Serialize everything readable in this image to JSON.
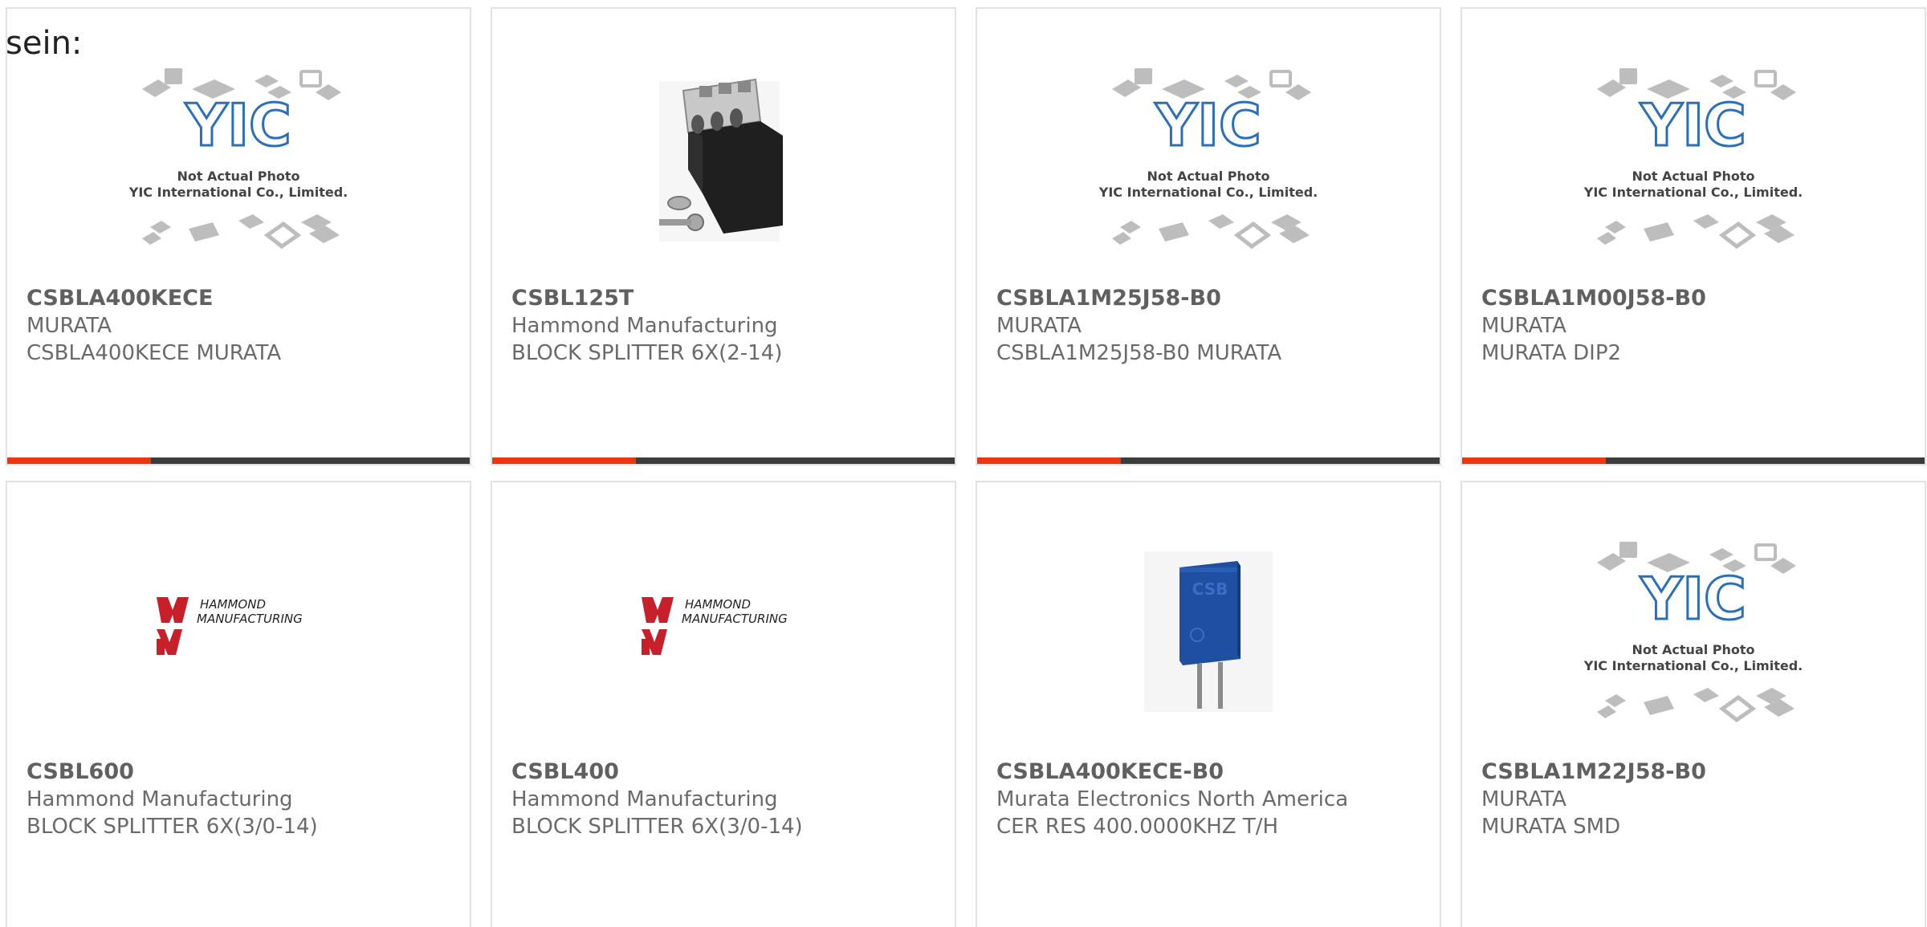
{
  "lead_text": "sein:",
  "colors": {
    "accent": "#e8380f",
    "track": "#3c3c3c",
    "yic_blue": "#2b6fb8",
    "hammond_red": "#c8202a",
    "csb_blue": "#1f4fa0"
  },
  "image_text": {
    "yic_logo": "YIC",
    "not_actual_line1": "Not Actual Photo",
    "not_actual_line2": "YIC International Co., Limited.",
    "hammond_line1": "HAMMOND",
    "hammond_line2": "MANUFACTURING",
    "csb_label": "CSB"
  },
  "products": [
    {
      "part_number": "CSBLA400KECE",
      "manufacturer": "MURATA",
      "description": "CSBLA400KECE MURATA",
      "image": "yic-placeholder",
      "progress": 0.31
    },
    {
      "part_number": "CSBL125T",
      "manufacturer": "Hammond Manufacturing",
      "description": "BLOCK SPLITTER 6X(2-14)",
      "image": "splitter-block-photo",
      "progress": 0.31
    },
    {
      "part_number": "CSBLA1M25J58-B0",
      "manufacturer": "MURATA",
      "description": "CSBLA1M25J58-B0 MURATA",
      "image": "yic-placeholder",
      "progress": 0.31
    },
    {
      "part_number": "CSBLA1M00J58-B0",
      "manufacturer": "MURATA",
      "description": "MURATA DIP2",
      "image": "yic-placeholder",
      "progress": 0.31
    },
    {
      "part_number": "CSBL600",
      "manufacturer": "Hammond Manufacturing",
      "description": "BLOCK SPLITTER 6X(3/0-14)",
      "image": "hammond-logo",
      "progress": 0
    },
    {
      "part_number": "CSBL400",
      "manufacturer": "Hammond Manufacturing",
      "description": "BLOCK SPLITTER 6X(3/0-14)",
      "image": "hammond-logo",
      "progress": 0
    },
    {
      "part_number": "CSBLA400KECE-B0",
      "manufacturer": "Murata Electronics North America",
      "description": "CER RES 400.0000KHZ T/H",
      "image": "csb-resonator-photo",
      "progress": 0
    },
    {
      "part_number": "CSBLA1M22J58-B0",
      "manufacturer": "MURATA",
      "description": "MURATA SMD",
      "image": "yic-placeholder",
      "progress": 0
    }
  ]
}
